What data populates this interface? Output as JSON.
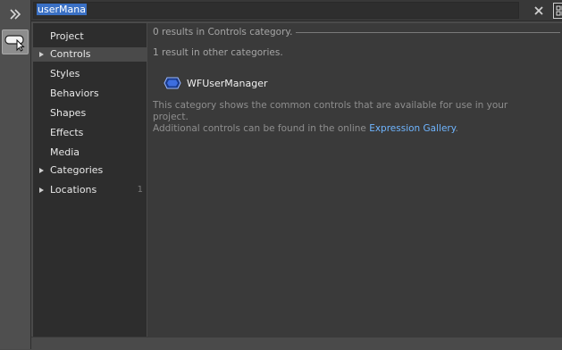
{
  "toolbar": {
    "expand_icon": "double-chevron-right-icon",
    "assets_icon": "assets-tool-icon"
  },
  "search": {
    "value": "userMana",
    "clear_icon": "close-icon",
    "grid_view_icon": "grid-view-icon",
    "list_view_icon": "list-view-icon"
  },
  "categories": [
    {
      "label": "Project",
      "expandable": false,
      "selected": false,
      "count": ""
    },
    {
      "label": "Controls",
      "expandable": true,
      "selected": true,
      "count": ""
    },
    {
      "label": "Styles",
      "expandable": false,
      "selected": false,
      "count": ""
    },
    {
      "label": "Behaviors",
      "expandable": false,
      "selected": false,
      "count": ""
    },
    {
      "label": "Shapes",
      "expandable": false,
      "selected": false,
      "count": ""
    },
    {
      "label": "Effects",
      "expandable": false,
      "selected": false,
      "count": ""
    },
    {
      "label": "Media",
      "expandable": false,
      "selected": false,
      "count": ""
    },
    {
      "label": "Categories",
      "expandable": true,
      "selected": false,
      "count": ""
    },
    {
      "label": "Locations",
      "expandable": true,
      "selected": false,
      "count": "1"
    }
  ],
  "results": {
    "primary_header": "0 results in Controls category.",
    "secondary_header": "1 result in other categories.",
    "items": [
      {
        "name": "WFUserManager",
        "icon": "control-component-icon"
      }
    ],
    "description_line1": "This category shows the common controls that are available for use in your project.",
    "description_line2_prefix": "Additional controls can be found in the online ",
    "description_link": "Expression Gallery",
    "description_suffix": "."
  },
  "colors": {
    "background": "#4a4a4a",
    "panel": "#3a3a3a",
    "list": "#2d2d2d",
    "link": "#6fb5ff",
    "selection": "#3a70c4"
  }
}
